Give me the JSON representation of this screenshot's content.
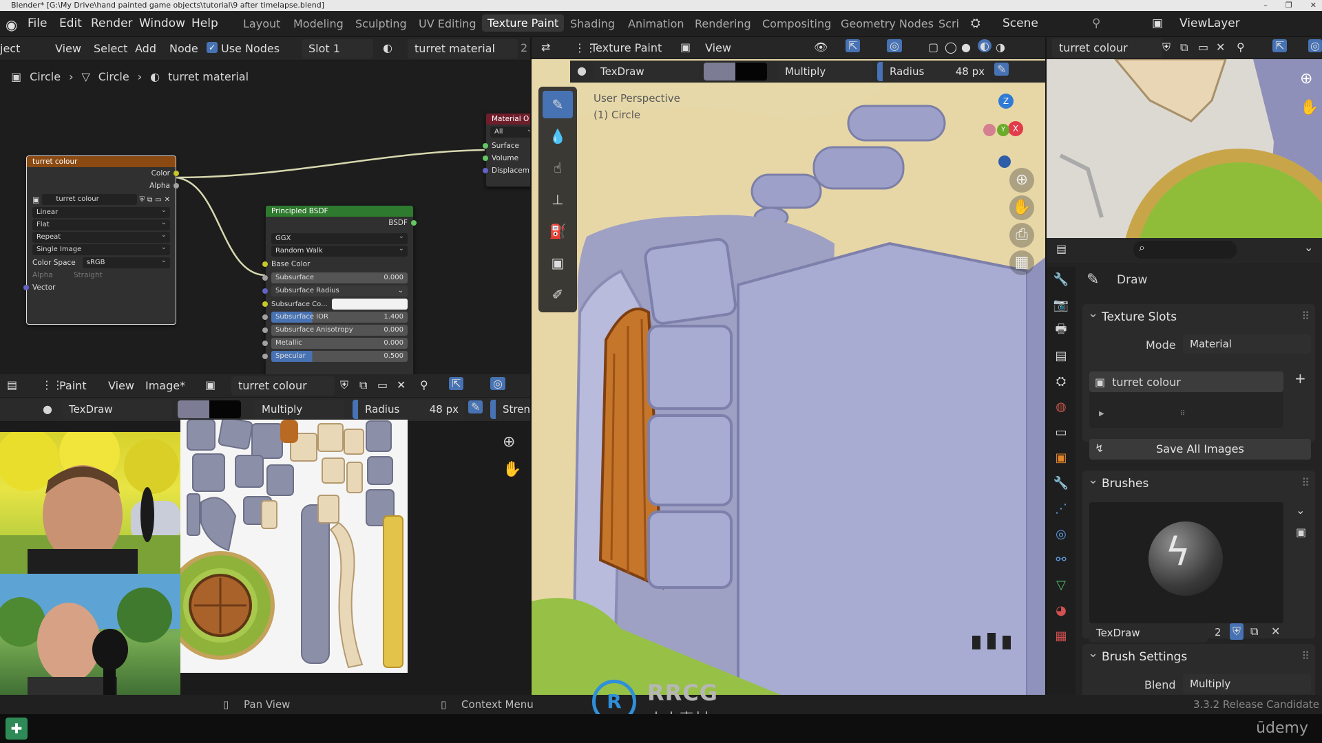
{
  "window_title": "Blender* [G:\\My Drive\\hand painted game objects\\tutorial\\9 after timelapse.blend]",
  "menu": [
    "File",
    "Edit",
    "Render",
    "Window",
    "Help"
  ],
  "workspaces": [
    "Layout",
    "Modeling",
    "Sculpting",
    "UV Editing",
    "Texture Paint",
    "Shading",
    "Animation",
    "Rendering",
    "Compositing",
    "Geometry Nodes",
    "Scri"
  ],
  "active_workspace": "Texture Paint",
  "scene": "Scene",
  "view_layer": "ViewLayer",
  "node_editor": {
    "header": {
      "object_label": "ject",
      "view": "View",
      "select": "Select",
      "add": "Add",
      "node": "Node",
      "use_nodes": "Use Nodes",
      "slot": "Slot 1",
      "material": "turret material",
      "users": "2"
    },
    "breadcrumb": [
      "Circle",
      "Circle",
      "turret material"
    ],
    "image_node": {
      "title": "turret colour",
      "out_color": "Color",
      "out_alpha": "Alpha",
      "image": "turret colour",
      "interpolation": "Linear",
      "projection": "Flat",
      "extension": "Repeat",
      "source": "Single Image",
      "color_space_label": "Color Space",
      "color_space": "sRGB",
      "alpha_label": "Alpha",
      "alpha_value": "Straight",
      "vector": "Vector"
    },
    "bsdf_node": {
      "title": "Principled BSDF",
      "out": "BSDF",
      "distribution": "GGX",
      "sss_method": "Random Walk",
      "base_color": "Base Color",
      "rows": [
        {
          "label": "Subsurface",
          "value": "0.000"
        },
        {
          "label": "Subsurface Radius",
          "value": ""
        },
        {
          "label": "Subsurface Co...",
          "value": ""
        },
        {
          "label": "Subsurface IOR",
          "value": "1.400"
        },
        {
          "label": "Subsurface Anisotropy",
          "value": "0.000"
        },
        {
          "label": "Metallic",
          "value": "0.000"
        },
        {
          "label": "Specular",
          "value": "0.500"
        }
      ]
    },
    "output_node": {
      "title": "Material O",
      "target": "All",
      "surface": "Surface",
      "volume": "Volume",
      "displacement": "Displacem"
    }
  },
  "image_editor": {
    "mode": "Paint",
    "view": "View",
    "image_menu": "Image*",
    "image_name": "turret colour",
    "brush": "TexDraw",
    "blend": "Multiply",
    "radius_label": "Radius",
    "radius_value": "48 px",
    "strength_label": "Streng"
  },
  "viewport": {
    "mode": "Texture Paint",
    "view": "View",
    "brush": "TexDraw",
    "blend": "Multiply",
    "radius_label": "Radius",
    "radius_value": "48 px",
    "overlay_text_1": "User Perspective",
    "overlay_text_2": "(1) Circle",
    "gizmo": {
      "z": "Z",
      "y": "Y",
      "x": "X"
    }
  },
  "image_preview": {
    "image_name": "turret colour"
  },
  "properties": {
    "tool_name": "Draw",
    "texture_slots": {
      "title": "Texture Slots",
      "mode_label": "Mode",
      "mode": "Material",
      "slot": "turret colour",
      "save_all": "Save All Images"
    },
    "brushes": {
      "title": "Brushes",
      "name": "TexDraw",
      "users": "2"
    },
    "brush_settings": {
      "title": "Brush Settings",
      "blend_label": "Blend",
      "blend": "Multiply"
    }
  },
  "status": {
    "pan": "Pan View",
    "context": "Context Menu",
    "version": "3.3.2 Release Candidate"
  },
  "watermark": {
    "main": "RRCG",
    "sub": "人人素材",
    "udemy": "ūdemy"
  },
  "colors": {
    "accent": "#4772b3",
    "node_image_header": "#8b4a12",
    "node_bsdf_header": "#2e7a2e",
    "node_output_header": "#6e1e2a"
  }
}
